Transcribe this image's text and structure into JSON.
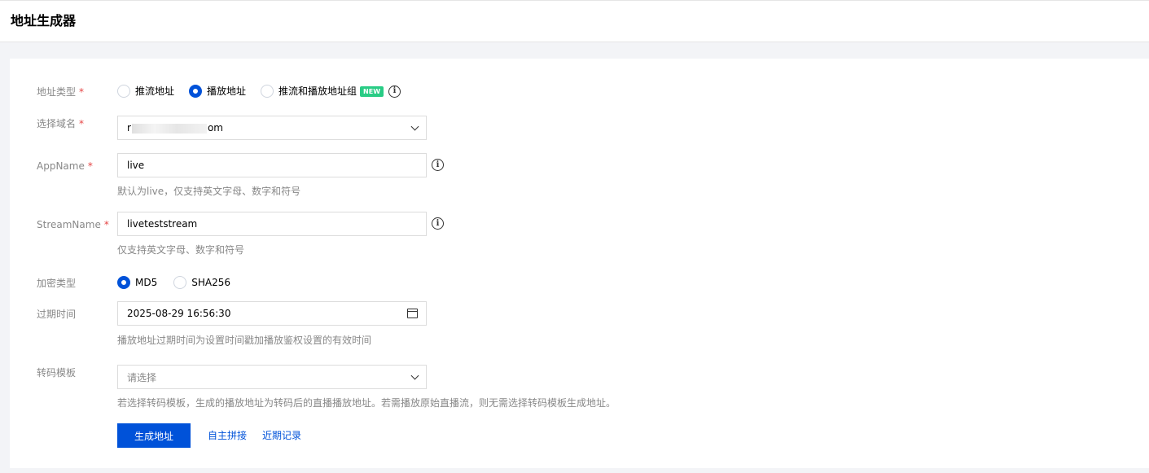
{
  "header": {
    "title": "地址生成器"
  },
  "form": {
    "address_type": {
      "label": "地址类型",
      "required_mark": "*",
      "options": [
        "推流地址",
        "播放地址",
        "推流和播放地址组"
      ],
      "selected": "播放地址",
      "badge": "NEW",
      "info_icon": "info-icon"
    },
    "domain": {
      "label": "选择域名",
      "required_mark": "*",
      "value_prefix": "r",
      "value_suffix": "om",
      "icon": "chevron-down-icon"
    },
    "app_name": {
      "label": "AppName",
      "required_mark": "*",
      "value": "live",
      "hint": "默认为live，仅支持英文字母、数字和符号",
      "info_icon": "info-icon"
    },
    "stream_name": {
      "label": "StreamName",
      "required_mark": "*",
      "value": "liveteststream",
      "hint": "仅支持英文字母、数字和符号",
      "info_icon": "info-icon"
    },
    "encryption": {
      "label": "加密类型",
      "options": [
        "MD5",
        "SHA256"
      ],
      "selected": "MD5"
    },
    "expiry": {
      "label": "过期时间",
      "value": "2025-08-29 16:56:30",
      "hint": "播放地址过期时间为设置时间戳加播放鉴权设置的有效时间",
      "icon": "calendar-icon"
    },
    "transcode": {
      "label": "转码模板",
      "placeholder": "请选择",
      "hint": "若选择转码模板，生成的播放地址为转码后的直播播放地址。若需播放原始直播流，则无需选择转码模板生成地址。",
      "icon": "chevron-down-icon"
    }
  },
  "actions": {
    "generate": "生成地址",
    "custom": "自主拼接",
    "recent": "近期记录"
  },
  "colors": {
    "primary": "#0052d9",
    "required": "#e54545",
    "badge": "#29cc85"
  }
}
